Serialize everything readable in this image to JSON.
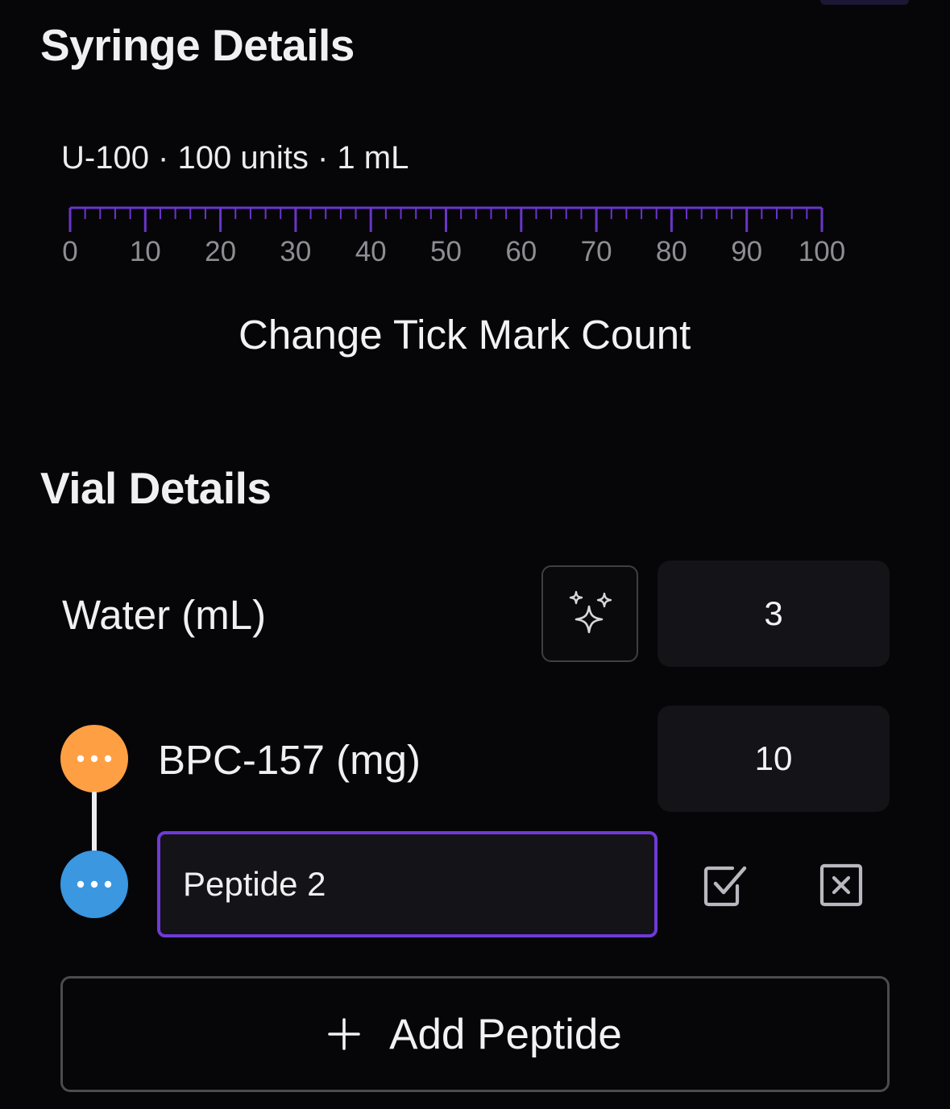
{
  "syringe": {
    "title": "Syringe Details",
    "info": "U-100 · 100 units · 1 mL",
    "ruler": {
      "min": 0,
      "max": 100,
      "minor_step": 2,
      "labels": [
        "0",
        "10",
        "20",
        "30",
        "40",
        "50",
        "60",
        "70",
        "80",
        "90",
        "100"
      ],
      "color": "#6a35c9"
    },
    "change_tick_label": "Change Tick Mark Count"
  },
  "vial": {
    "title": "Vial Details",
    "water": {
      "label": "Water (mL)",
      "value": "3",
      "auto_icon": "sparkles-icon"
    },
    "peptides": [
      {
        "label": "BPC-157 (mg)",
        "value": "10",
        "color": "#ff9f43",
        "menu_icon": "more-horizontal-icon"
      }
    ],
    "new_peptide": {
      "name_value": "Peptide 2",
      "color": "#3a97e0",
      "menu_icon": "more-horizontal-icon",
      "confirm_icon": "checkbox-check-icon",
      "cancel_icon": "close-square-icon"
    },
    "add_button": {
      "icon": "plus-icon",
      "label": "Add Peptide"
    }
  },
  "colors": {
    "background": "#060609",
    "field": "#131318",
    "accent_purple": "#6f3ad6"
  }
}
